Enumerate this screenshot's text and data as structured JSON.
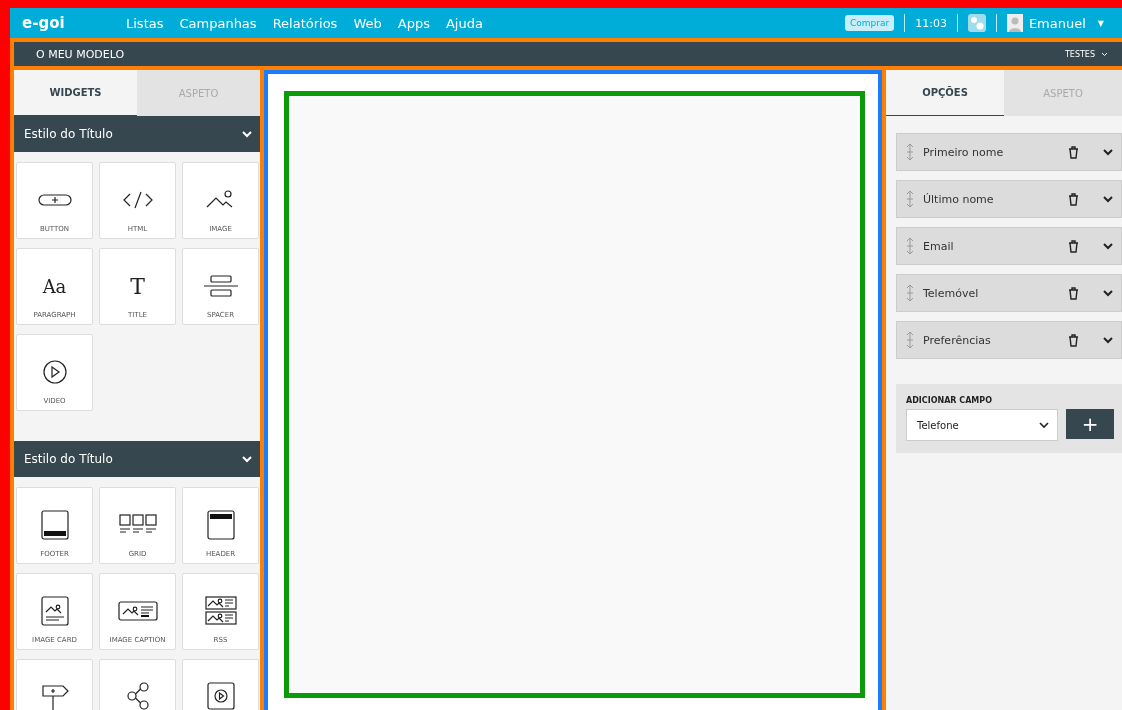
{
  "topbar": {
    "logo": "e-goi",
    "nav": [
      "Listas",
      "Campanhas",
      "Relatórios",
      "Web",
      "Apps",
      "Ajuda"
    ],
    "buy": "Comprar",
    "time": "11:03",
    "user": "Emanuel",
    "caret": "▼"
  },
  "subheader": {
    "title": "O MEU MODELO",
    "menu": "TESTES"
  },
  "left_panel": {
    "tabs": [
      {
        "label": "WIDGETS",
        "selected": true
      },
      {
        "label": "ASPETO",
        "selected": false
      }
    ],
    "sections": [
      {
        "title": "Estilo do Título",
        "expanded": true,
        "widgets": [
          {
            "kind": "button",
            "label": "BUTTON"
          },
          {
            "kind": "html",
            "label": "HTML"
          },
          {
            "kind": "image",
            "label": "IMAGE"
          },
          {
            "kind": "paragraph",
            "glyph": "Aa",
            "label": "PARAGRAPH"
          },
          {
            "kind": "title",
            "glyph": "T",
            "label": "TITLE"
          },
          {
            "kind": "spacer",
            "label": "SPACER"
          },
          {
            "kind": "video",
            "label": "VIDEO"
          }
        ]
      },
      {
        "title": "Estilo do Título",
        "expanded": true,
        "widgets": [
          {
            "kind": "footer",
            "label": "FOOTER"
          },
          {
            "kind": "grid",
            "label": "GRID"
          },
          {
            "kind": "header",
            "label": "HEADER"
          },
          {
            "kind": "image-card",
            "label": "IMAGE CARD"
          },
          {
            "kind": "image-caption",
            "label": "IMAGE CAPTION"
          },
          {
            "kind": "rss",
            "label": "RSS"
          },
          {
            "kind": "signpost"
          },
          {
            "kind": "share"
          },
          {
            "kind": "video-box"
          }
        ]
      }
    ]
  },
  "right_panel": {
    "tabs": [
      {
        "label": "OPÇÕES",
        "selected": true
      },
      {
        "label": "ASPETO",
        "selected": false
      }
    ],
    "fields": [
      {
        "label": "Primeiro nome"
      },
      {
        "label": "Último nome"
      },
      {
        "label": "Email"
      },
      {
        "label": "Telemóvel"
      },
      {
        "label": "Preferências"
      }
    ],
    "add_field": {
      "title": "ADICIONAR CAMPO",
      "value": "Telefone",
      "button": "+"
    }
  }
}
